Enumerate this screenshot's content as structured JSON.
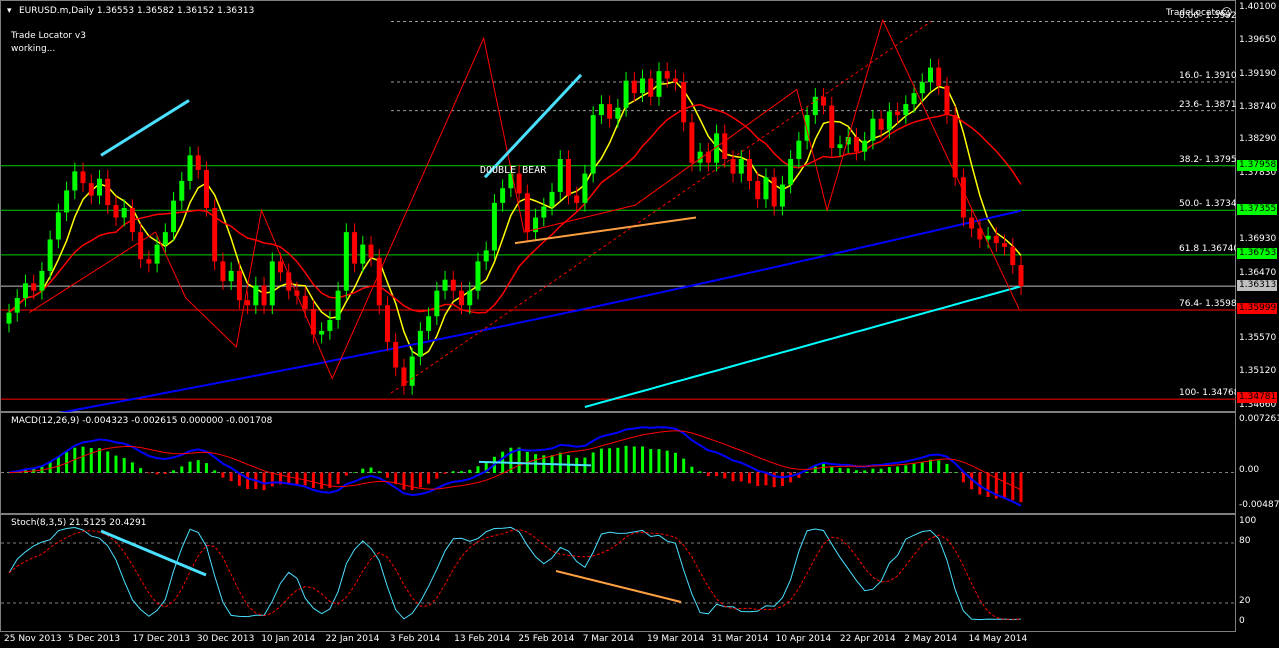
{
  "header": {
    "symbol_line": "EURUSD.m,Daily  1.36553 1.36582 1.36152 1.36313",
    "indicator_name": "Trade Locator v3",
    "indicator_status": "working...",
    "brand": "TradeLocator"
  },
  "annotation": {
    "text": "DOUBLE BEAR",
    "color": "#e6e600"
  },
  "price_axis": {
    "min": 1.3466,
    "max": 1.401,
    "ticks": [
      "1.40100",
      "1.39650",
      "1.39190",
      "1.38740",
      "1.38290",
      "1.37830",
      "1.36930",
      "1.36470",
      "1.35570",
      "1.35120",
      "1.34660"
    ]
  },
  "fib_levels": [
    {
      "label": "0.00- 1.39929",
      "price": 1.39929
    },
    {
      "label": "16.0- 1.39103",
      "price": 1.39103
    },
    {
      "label": "23.6- 1.38711",
      "price": 1.38711
    },
    {
      "label": "38.2- 1.37957",
      "price": 1.37957
    },
    {
      "label": "50.0- 1.37349",
      "price": 1.37349
    },
    {
      "label": "61.8 1.36740",
      "price": 1.3674
    },
    {
      "label": "76.4- 1.35986",
      "price": 1.35986
    },
    {
      "label": "100- 1.34768",
      "price": 1.34768
    }
  ],
  "price_badges": [
    {
      "label": "1.37958",
      "price": 1.37958,
      "color": "#00ff00"
    },
    {
      "label": "1.37355",
      "price": 1.37355,
      "color": "#00ff00"
    },
    {
      "label": "1.36753",
      "price": 1.36753,
      "color": "#00ff00"
    },
    {
      "label": "1.36313",
      "price": 1.36313,
      "color": "#c0c0c0"
    },
    {
      "label": "1.35999",
      "price": 1.35999,
      "color": "#ff0000"
    },
    {
      "label": "1.34781",
      "price": 1.34781,
      "color": "#ff0000"
    }
  ],
  "macd": {
    "label": "MACD(12,26,9) -0.004323 -0.002615 0.000000 -0.001708",
    "ticks": [
      "0.007261",
      "0.00",
      "-0.004875"
    ],
    "max": 0.007261,
    "min": -0.004875
  },
  "stoch": {
    "label": "Stoch(8,3,5) 21.5125 20.4291",
    "ticks": [
      "100",
      "80",
      "20",
      "0"
    ]
  },
  "time_axis": [
    "25 Nov 2013",
    "5 Dec 2013",
    "17 Dec 2013",
    "30 Dec 2013",
    "10 Jan 2014",
    "22 Jan 2014",
    "3 Feb 2014",
    "13 Feb 2014",
    "25 Feb 2014",
    "7 Mar 2014",
    "19 Mar 2014",
    "31 Mar 2014",
    "10 Apr 2014",
    "22 Apr 2014",
    "2 May 2014",
    "14 May 2014"
  ],
  "colors": {
    "bull": "#00ff00",
    "bear": "#ff0000",
    "ma_fast": "#ffff00",
    "ma_mid": "#ff0000",
    "ma_slow": "#0000ff",
    "ma_long": "#00ffff",
    "grid": "#00ff00"
  },
  "chart_data": {
    "type": "candlestick",
    "title": "EURUSD.m,Daily",
    "close_series": [
      1.3595,
      1.3615,
      1.3635,
      1.3625,
      1.3652,
      1.3695,
      1.3732,
      1.3762,
      1.3788,
      1.3772,
      1.3755,
      1.3778,
      1.3742,
      1.3725,
      1.3738,
      1.3705,
      1.3668,
      1.3662,
      1.3688,
      1.3705,
      1.3748,
      1.3775,
      1.381,
      1.379,
      1.3738,
      1.3665,
      1.3638,
      1.3652,
      1.3612,
      1.3605,
      1.3632,
      1.3605,
      1.3665,
      1.365,
      1.3625,
      1.3618,
      1.36,
      1.3565,
      1.357,
      1.3585,
      1.3625,
      1.3705,
      1.3662,
      1.3688,
      1.367,
      1.3605,
      1.3555,
      1.352,
      1.3495,
      1.3535,
      1.357,
      1.359,
      1.3625,
      1.364,
      1.3625,
      1.3605,
      1.3625,
      1.3665,
      1.368,
      1.3745,
      1.3765,
      1.3785,
      1.3758,
      1.3705,
      1.3725,
      1.374,
      1.376,
      1.3805,
      1.3755,
      1.3745,
      1.3785,
      1.3865,
      1.388,
      1.386,
      1.3875,
      1.3912,
      1.3895,
      1.3915,
      1.389,
      1.3925,
      1.3915,
      1.391,
      1.3855,
      1.38,
      1.3815,
      1.38,
      1.384,
      1.3805,
      1.3785,
      1.3805,
      1.3775,
      1.375,
      1.378,
      1.374,
      1.377,
      1.3805,
      1.383,
      1.3865,
      1.389,
      1.3878,
      1.382,
      1.3825,
      1.3835,
      1.3815,
      1.383,
      1.386,
      1.3845,
      1.387,
      1.3865,
      1.388,
      1.3895,
      1.391,
      1.393,
      1.3905,
      1.3865,
      1.378,
      1.3725,
      1.371,
      1.3695,
      1.37,
      1.369,
      1.3685,
      1.366,
      1.3631
    ],
    "ylim": [
      1.3466,
      1.401
    ]
  }
}
